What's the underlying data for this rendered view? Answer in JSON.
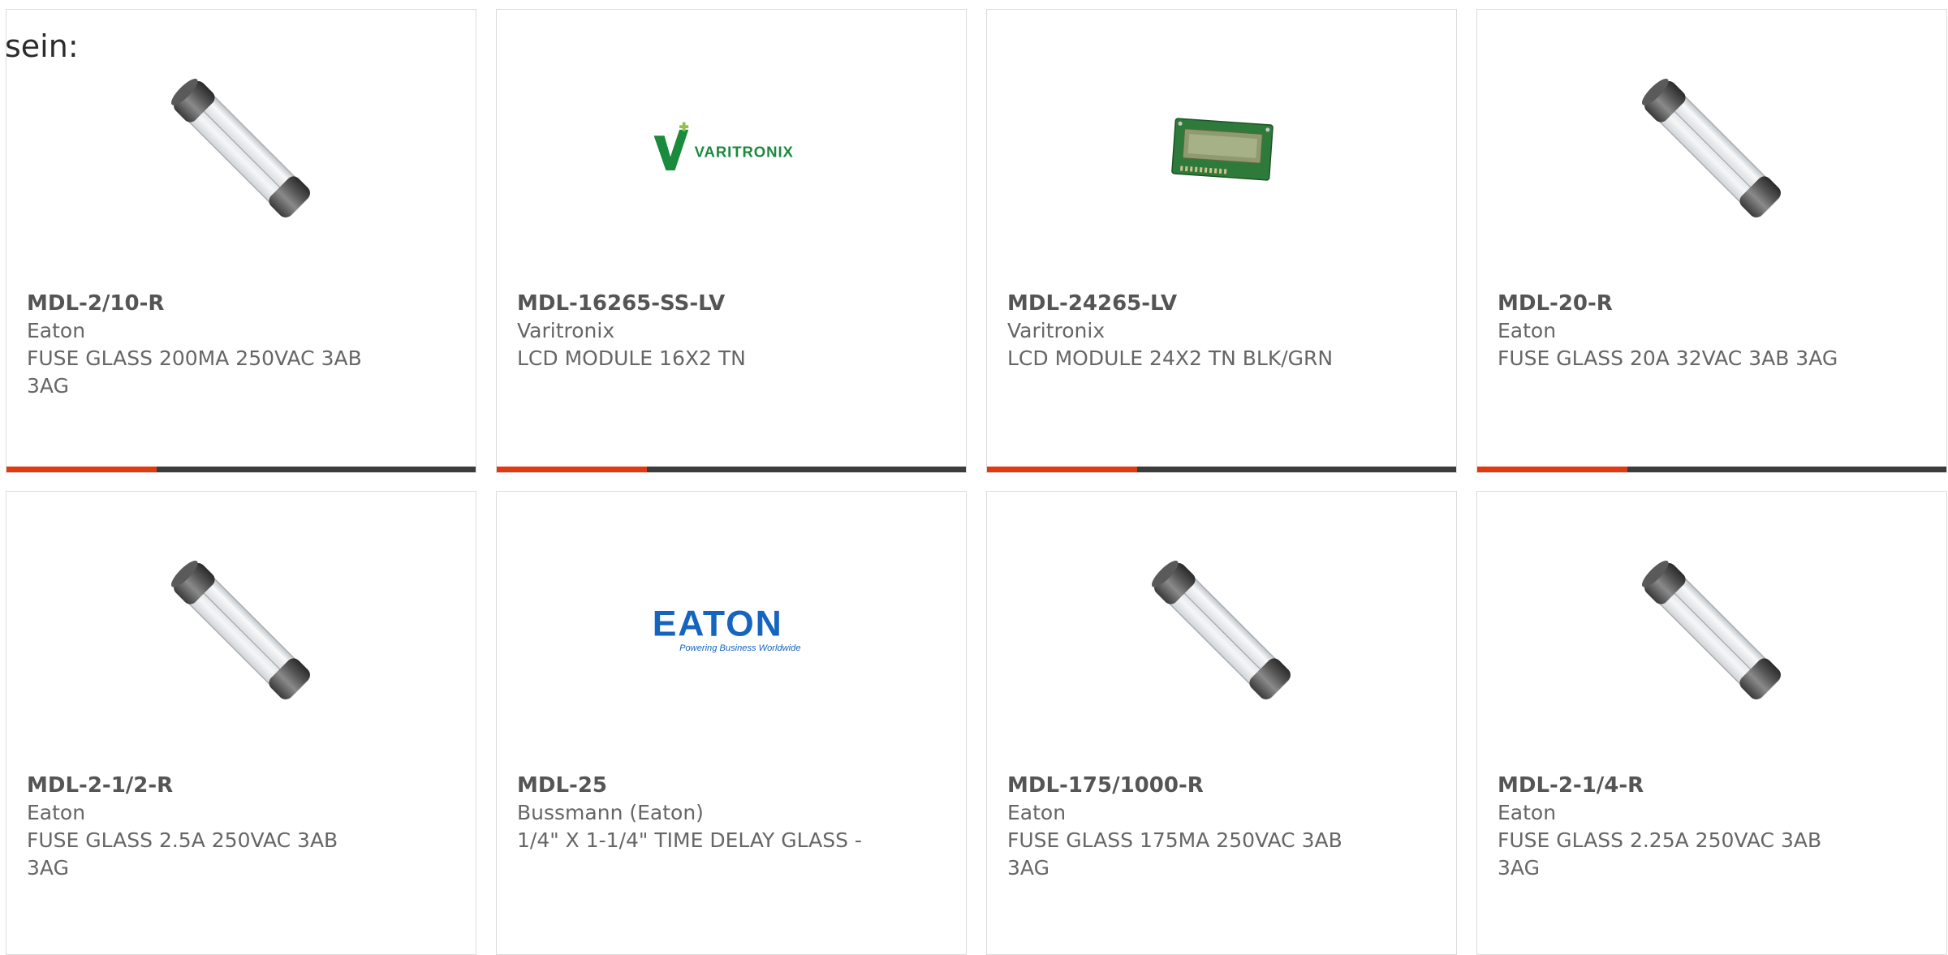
{
  "intro_text": "sein:",
  "colors": {
    "accent": "#e03a10",
    "bar_dark": "#3c3c3c",
    "part_text": "#555555",
    "body_text": "#666666",
    "varitronix_green": "#1a8a3c",
    "eaton_blue": "#1565c0"
  },
  "products": [
    {
      "part_number": "MDL-2/10-R",
      "manufacturer": "Eaton",
      "description": "FUSE GLASS 200MA 250VAC 3AB 3AG",
      "image": "glass-fuse",
      "progress": 0.32
    },
    {
      "part_number": "MDL-16265-SS-LV",
      "manufacturer": "Varitronix",
      "description": "LCD MODULE 16X2 TN",
      "image": "varitronix-logo",
      "logo_text": "VARITRONIX",
      "progress": 0.32
    },
    {
      "part_number": "MDL-24265-LV",
      "manufacturer": "Varitronix",
      "description": "LCD MODULE 24X2 TN BLK/GRN",
      "image": "lcd-module",
      "progress": 0.32
    },
    {
      "part_number": "MDL-20-R",
      "manufacturer": "Eaton",
      "description": "FUSE GLASS 20A 32VAC 3AB 3AG",
      "image": "glass-fuse",
      "progress": 0.32
    },
    {
      "part_number": "MDL-2-1/2-R",
      "manufacturer": "Eaton",
      "description": "FUSE GLASS 2.5A 250VAC 3AB 3AG",
      "image": "glass-fuse"
    },
    {
      "part_number": "MDL-25",
      "manufacturer": "Bussmann (Eaton)",
      "description": "1/4\" X 1-1/4\" TIME DELAY GLASS -",
      "image": "eaton-logo",
      "logo_text": "EATON",
      "logo_tagline": "Powering Business Worldwide"
    },
    {
      "part_number": "MDL-175/1000-R",
      "manufacturer": "Eaton",
      "description": "FUSE GLASS 175MA 250VAC 3AB 3AG",
      "image": "glass-fuse"
    },
    {
      "part_number": "MDL-2-1/4-R",
      "manufacturer": "Eaton",
      "description": "FUSE GLASS 2.25A 250VAC 3AB 3AG",
      "image": "glass-fuse"
    }
  ]
}
